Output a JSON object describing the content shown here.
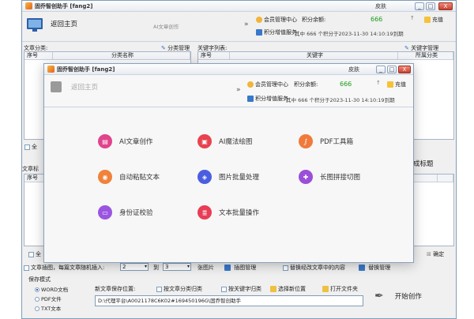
{
  "app": {
    "title": "固乔智创助手 [fang2]",
    "skin_label": "皮肤"
  },
  "window_buttons": {
    "min": "_",
    "max": "□",
    "close": "X"
  },
  "header": {
    "back_label": "返回主页",
    "current_module": "AI文章创作",
    "member_center": "会员管理中心",
    "points_label": "积分余额:",
    "points_value": "666",
    "recharge_label": "充值",
    "points_service": "积分增值服务",
    "points_detail": "其中 666 个积分于2023-11-30 14:10:19到期"
  },
  "left_panel": {
    "title": "文章分类:",
    "manage_label": "分类管理",
    "columns": [
      "序号",
      "分类名称"
    ]
  },
  "right_panel": {
    "title": "关键字列表:",
    "manage_label": "关键字管理",
    "columns": [
      "序号",
      "关键字",
      "所属分类"
    ]
  },
  "behind": {
    "select_all_1": "全",
    "article_list": "文章标",
    "seq_col": "序号",
    "generate_title": "成标题",
    "select_all_2": "全",
    "confirm_label": "确定",
    "insert_label": "文章插图，每篇文章随机插入:",
    "from_value": "2",
    "to_label": "到",
    "to_value": "3",
    "unit_label": "张图片",
    "image_mgmt": "插图管理",
    "replace_label": "替换经改文章中的内容",
    "replace_mgmt": "替换管理",
    "save_mode": "保存模式",
    "save_options": [
      "WORD文档",
      "PDF文件",
      "TXT文本"
    ],
    "save_path_label": "新文章保存位置:",
    "by_category": "按文章分类归类",
    "by_keyword": "按关键字归类",
    "choose_location": "选择新位置",
    "open_folder": "打开文件夹",
    "save_path": "D:\\代理平台\\A0021178C6K02#169450196G\\固乔智创助手",
    "start_label": "开始创作"
  },
  "dialog": {
    "title": "固乔智创助手 [fang2]",
    "skin_label": "皮肤",
    "back_label": "返回主页",
    "member_center": "会员管理中心",
    "points_label": "积分余额:",
    "points_value": "666",
    "recharge_label": "充值",
    "points_service": "积分增值服务",
    "points_detail": "其中 666 个积分于2023-11-30 14:10:19到期",
    "tools": [
      {
        "label": "AI文章创作",
        "icon": "document-icon",
        "color": "#e0448c"
      },
      {
        "label": "AI魔法绘图",
        "icon": "image-icon",
        "color": "#e8434f"
      },
      {
        "label": "PDF工具箱",
        "icon": "pdf-icon",
        "color": "#f07a3a"
      },
      {
        "label": "自动粘贴文本",
        "icon": "paste-icon",
        "color": "#f0823a"
      },
      {
        "label": "图片批量处理",
        "icon": "layers-icon",
        "color": "#4b5ee0"
      },
      {
        "label": "长图拼接切图",
        "icon": "puzzle-icon",
        "color": "#9a4fd8"
      },
      {
        "label": "身份证校验",
        "icon": "id-card-icon",
        "color": "#9a55e0"
      },
      {
        "label": "文本批量操作",
        "icon": "text-icon",
        "color": "#e83d55"
      }
    ]
  }
}
